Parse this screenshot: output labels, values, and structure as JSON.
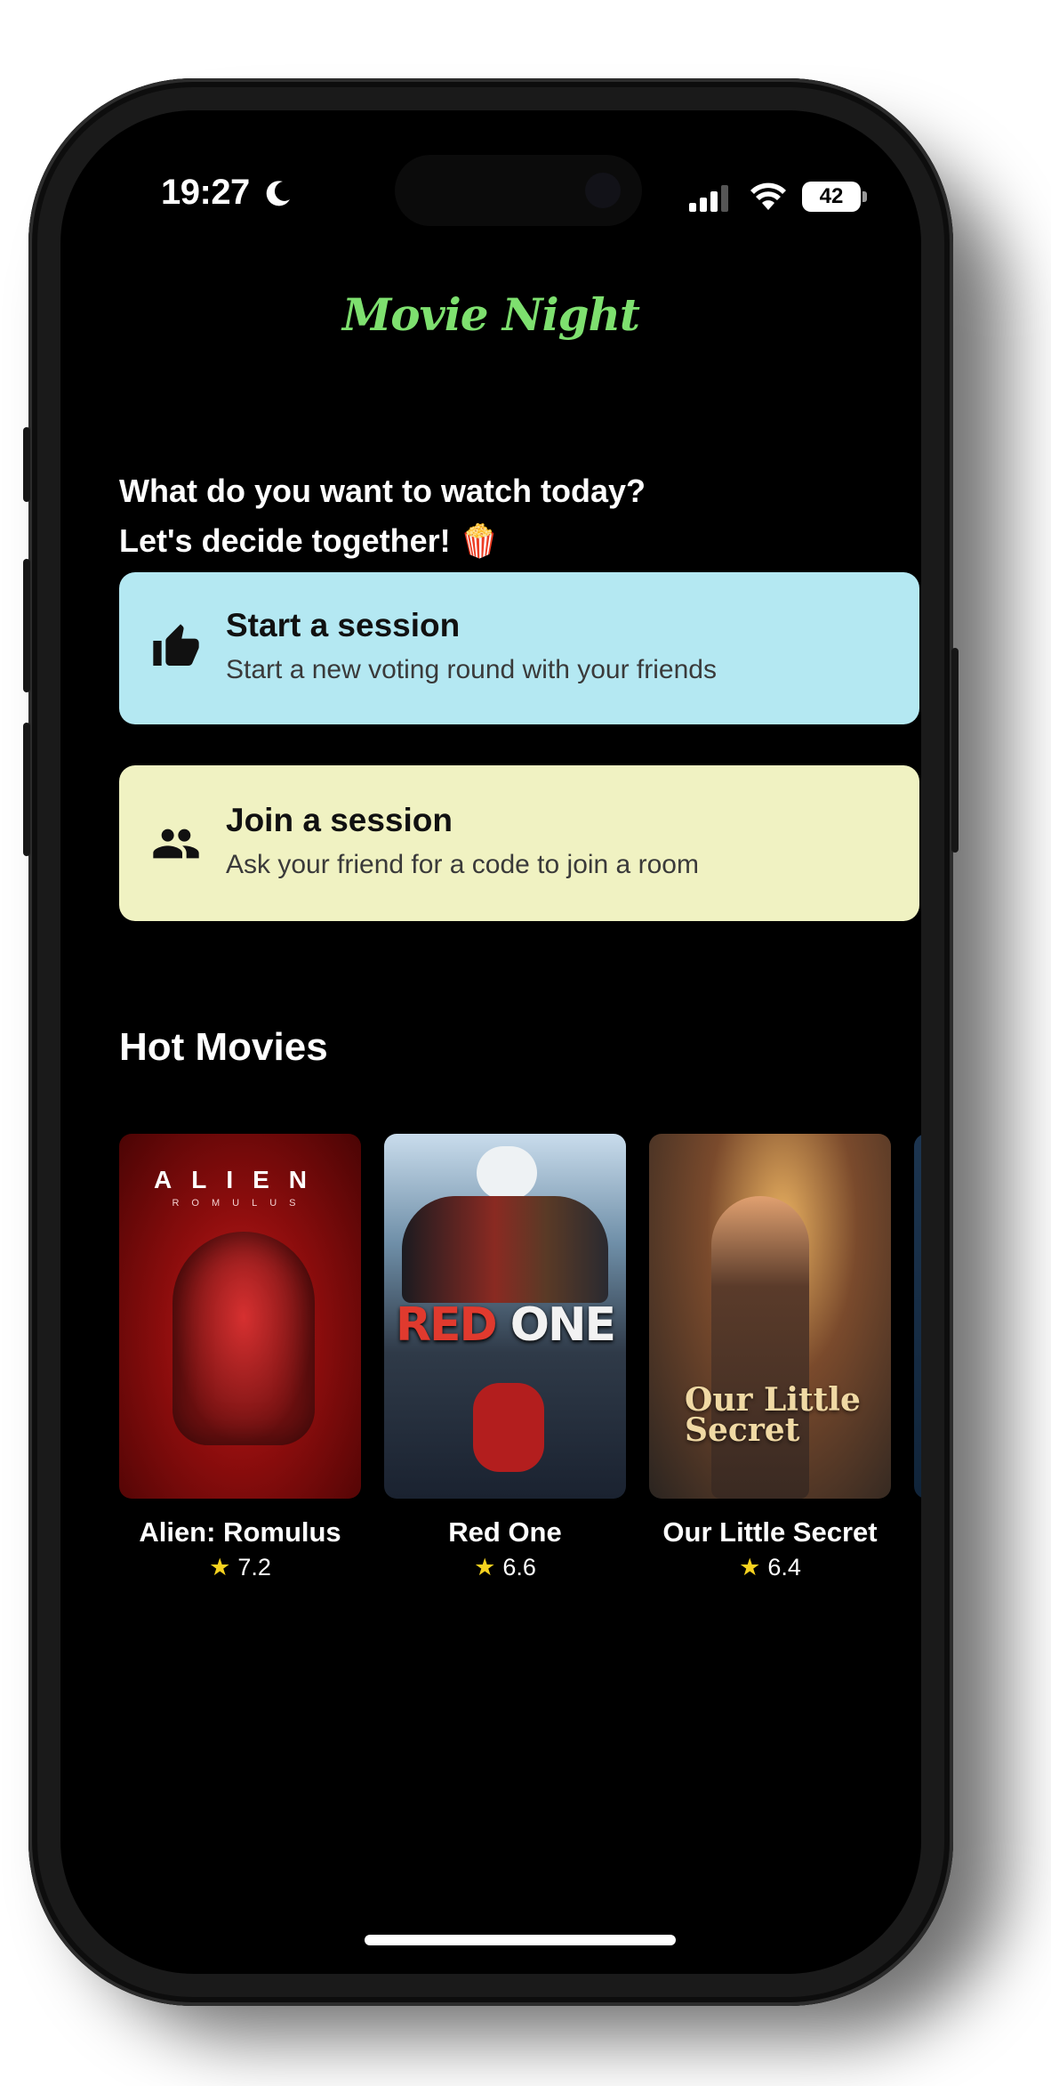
{
  "status_bar": {
    "time": "19:27",
    "battery": "42"
  },
  "app": {
    "title": "Movie Night"
  },
  "intro": {
    "line1": "What do you want to watch today?",
    "line2": "Let's decide together! 🍿"
  },
  "actions": [
    {
      "title": "Start a session",
      "subtitle": "Start a new voting round with your friends",
      "icon": "thumbs-up-icon",
      "color": "#b4e8f2"
    },
    {
      "title": "Join a session",
      "subtitle": "Ask your friend for a code to join a room",
      "icon": "group-icon",
      "color": "#f0f2c2"
    }
  ],
  "hot_movies": {
    "heading": "Hot Movies",
    "items": [
      {
        "title": "Alien: Romulus",
        "rating": "7.2",
        "poster_text": "ALIEN",
        "poster_subtext": "ROMULUS"
      },
      {
        "title": "Red One",
        "rating": "6.6",
        "poster_text_a": "RED",
        "poster_text_b": "ONE"
      },
      {
        "title": "Our Little Secret",
        "rating": "6.4",
        "poster_text": "Our Little Secret"
      }
    ]
  },
  "colors": {
    "accent_green": "#7ee06f",
    "star": "#f6d21f",
    "background": "#000000"
  }
}
